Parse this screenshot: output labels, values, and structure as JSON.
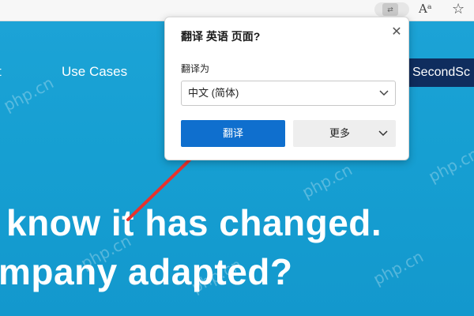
{
  "browser": {
    "read_aloud_glyph": "Aᵃ",
    "favorite_glyph": "☆"
  },
  "page": {
    "nav": {
      "cut_item": "t",
      "use_cases": "Use Cases",
      "cta": "SecondSc"
    },
    "headline_line1": "know it has changed.",
    "headline_line2": "mpany adapted?",
    "watermark": "php.cn"
  },
  "translate_popup": {
    "title": "翻译 英语 页面?",
    "close_glyph": "✕",
    "target_label": "翻译为",
    "target_value": "中文 (简体)",
    "translate_button": "翻译",
    "more_button": "更多"
  },
  "colors": {
    "page_bg": "#169fd2",
    "primary_button": "#0f6fce",
    "cta_bg": "#0f2d5e",
    "arrow": "#e8322c"
  }
}
